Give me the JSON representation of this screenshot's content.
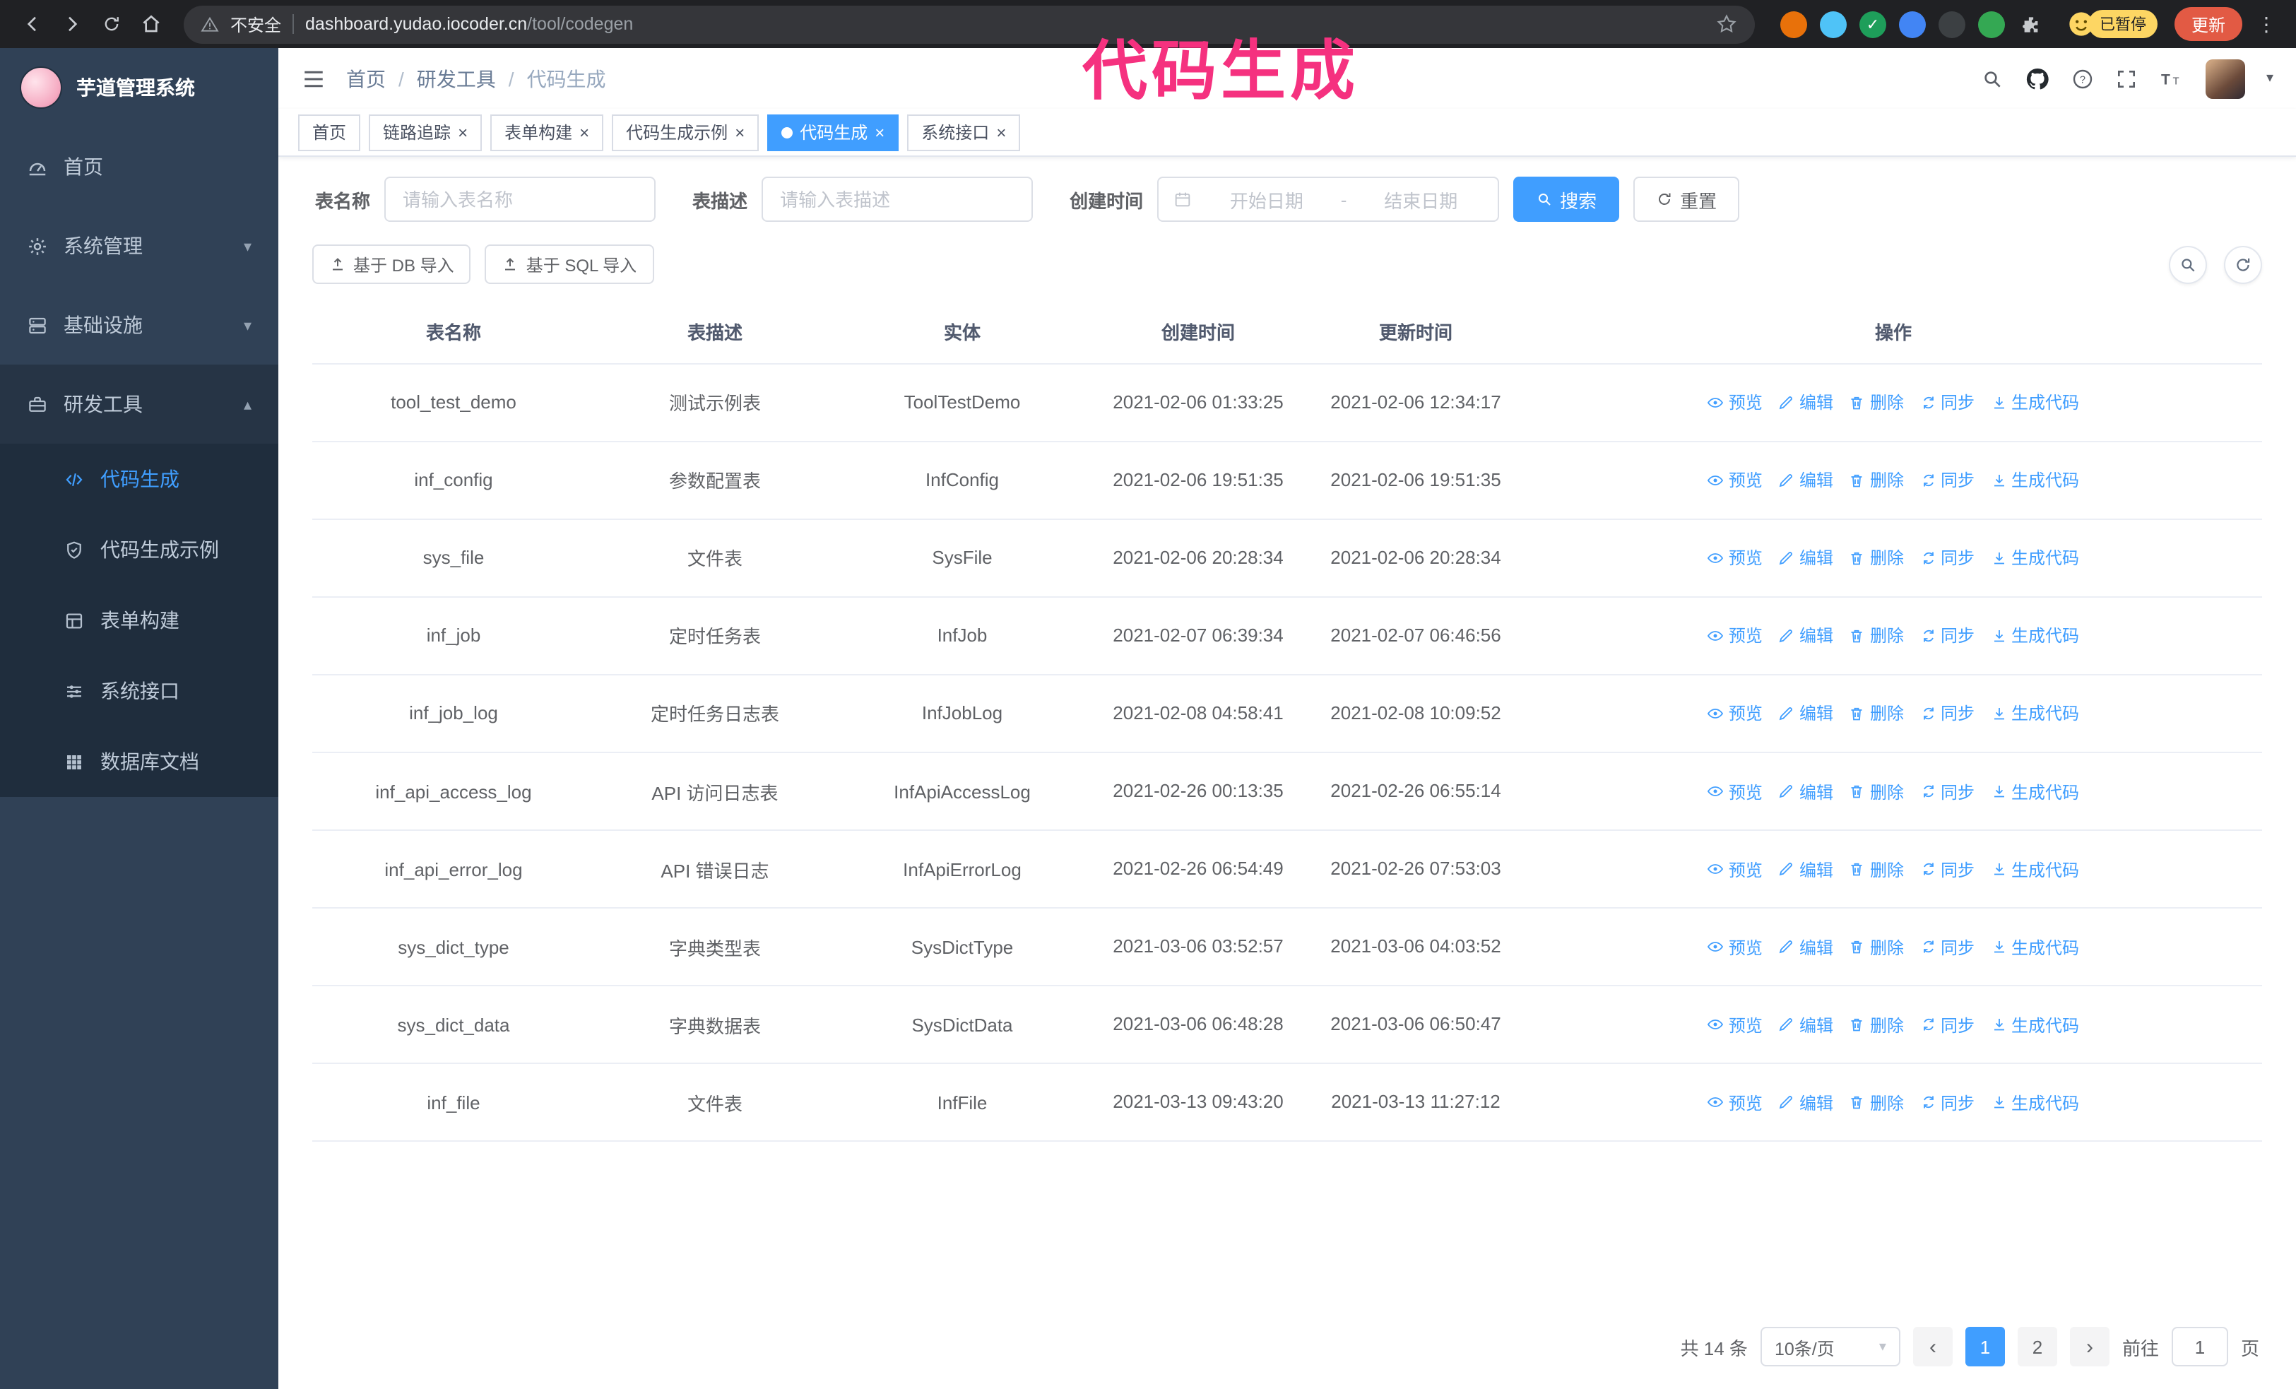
{
  "colors": {
    "primary": "#409eff",
    "annotation": "#f5317f",
    "sidebar_bg": "#304156",
    "submenu_bg": "#1f2d3d",
    "sidebar_open": "#263445",
    "chrome_bg": "#202124",
    "omnibox": "#35363a",
    "update": "#e25a44",
    "badge": "#fdd663"
  },
  "browser": {
    "security_warning": "不安全",
    "url_domain": "dashboard.yudao.iocoder.cn",
    "url_path": "/tool/codegen",
    "profile_badge": "已暂停",
    "update_button": "更新",
    "extensions": [
      {
        "color": "#e8710a"
      },
      {
        "color": "#4fc3f7"
      },
      {
        "color": "#1e9e5a",
        "glyph": "✓"
      },
      {
        "color": "#4285f4"
      },
      {
        "color": "#3c4043"
      },
      {
        "color": "#34a853"
      },
      {
        "icon": "puzzle",
        "color": "#c7cacd"
      }
    ]
  },
  "annotation": {
    "text": "代码生成"
  },
  "sidebar": {
    "logo_title": "芋道管理系统",
    "items": [
      {
        "key": "home",
        "icon": "gauge",
        "label": "首页"
      },
      {
        "key": "system",
        "icon": "gear",
        "label": "系统管理",
        "expandable": true
      },
      {
        "key": "infra",
        "icon": "server",
        "label": "基础设施",
        "expandable": true
      },
      {
        "key": "devtools",
        "icon": "tools",
        "label": "研发工具",
        "expandable": true,
        "expanded": true
      }
    ],
    "submenu": [
      {
        "key": "codegen",
        "icon": "code",
        "label": "代码生成",
        "active": true
      },
      {
        "key": "codegen-demo",
        "icon": "shield",
        "label": "代码生成示例"
      },
      {
        "key": "form-builder",
        "icon": "tablegrid",
        "label": "表单构建"
      },
      {
        "key": "api",
        "icon": "sliders",
        "label": "系统接口"
      },
      {
        "key": "db-doc",
        "icon": "grid9",
        "label": "数据库文档"
      }
    ]
  },
  "header": {
    "breadcrumb": [
      "首页",
      "研发工具",
      "代码生成"
    ]
  },
  "tabs": [
    {
      "key": "home",
      "label": "首页"
    },
    {
      "key": "tracer",
      "label": "链路追踪",
      "closable": true
    },
    {
      "key": "form-builder",
      "label": "表单构建",
      "closable": true
    },
    {
      "key": "codegen-demo",
      "label": "代码生成示例",
      "closable": true
    },
    {
      "key": "codegen",
      "label": "代码生成",
      "closable": true,
      "active": true
    },
    {
      "key": "api",
      "label": "系统接口",
      "closable": true
    }
  ],
  "filters": {
    "table_name_label": "表名称",
    "table_name_placeholder": "请输入表名称",
    "table_desc_label": "表描述",
    "table_desc_placeholder": "请输入表描述",
    "create_time_label": "创建时间",
    "date_start_placeholder": "开始日期",
    "date_separator": "-",
    "date_end_placeholder": "结束日期",
    "search_button": "搜索",
    "reset_button": "重置"
  },
  "toolbar": {
    "import_db": "基于 DB 导入",
    "import_sql": "基于 SQL 导入"
  },
  "table": {
    "columns": [
      "表名称",
      "表描述",
      "实体",
      "创建时间",
      "更新时间",
      "操作"
    ],
    "actions": [
      {
        "key": "preview",
        "icon": "eye",
        "label": "预览"
      },
      {
        "key": "edit",
        "icon": "edit",
        "label": "编辑"
      },
      {
        "key": "delete",
        "icon": "trash",
        "label": "删除"
      },
      {
        "key": "sync",
        "icon": "sync",
        "label": "同步"
      },
      {
        "key": "generate-code",
        "icon": "download",
        "label": "生成代码"
      }
    ],
    "rows": [
      {
        "name": "tool_test_demo",
        "desc": "测试示例表",
        "entity": "ToolTestDemo",
        "created": "2021-02-06 01:33:25",
        "updated": "2021-02-06 12:34:17"
      },
      {
        "name": "inf_config",
        "desc": "参数配置表",
        "entity": "InfConfig",
        "created": "2021-02-06 19:51:35",
        "updated": "2021-02-06 19:51:35"
      },
      {
        "name": "sys_file",
        "desc": "文件表",
        "entity": "SysFile",
        "created": "2021-02-06 20:28:34",
        "updated": "2021-02-06 20:28:34"
      },
      {
        "name": "inf_job",
        "desc": "定时任务表",
        "entity": "InfJob",
        "created": "2021-02-07 06:39:34",
        "updated": "2021-02-07 06:46:56"
      },
      {
        "name": "inf_job_log",
        "desc": "定时任务日志表",
        "entity": "InfJobLog",
        "created": "2021-02-08 04:58:41",
        "updated": "2021-02-08 10:09:52"
      },
      {
        "name": "inf_api_access_log",
        "desc": "API 访问日志表",
        "entity": "InfApiAccessLog",
        "created": "2021-02-26 00:13:35",
        "updated": "2021-02-26 06:55:14"
      },
      {
        "name": "inf_api_error_log",
        "desc": "API 错误日志",
        "entity": "InfApiErrorLog",
        "created": "2021-02-26 06:54:49",
        "updated": "2021-02-26 07:53:03"
      },
      {
        "name": "sys_dict_type",
        "desc": "字典类型表",
        "entity": "SysDictType",
        "created": "2021-03-06 03:52:57",
        "updated": "2021-03-06 04:03:52"
      },
      {
        "name": "sys_dict_data",
        "desc": "字典数据表",
        "entity": "SysDictData",
        "created": "2021-03-06 06:48:28",
        "updated": "2021-03-06 06:50:47"
      },
      {
        "name": "inf_file",
        "desc": "文件表",
        "entity": "InfFile",
        "created": "2021-03-13 09:43:20",
        "updated": "2021-03-13 11:27:12"
      }
    ]
  },
  "pagination": {
    "total": "共 14 条",
    "page_size": "10条/页",
    "pages": [
      "1",
      "2"
    ],
    "active_page": "1",
    "goto_label": "前往",
    "goto_value": "1",
    "goto_suffix": "页"
  }
}
